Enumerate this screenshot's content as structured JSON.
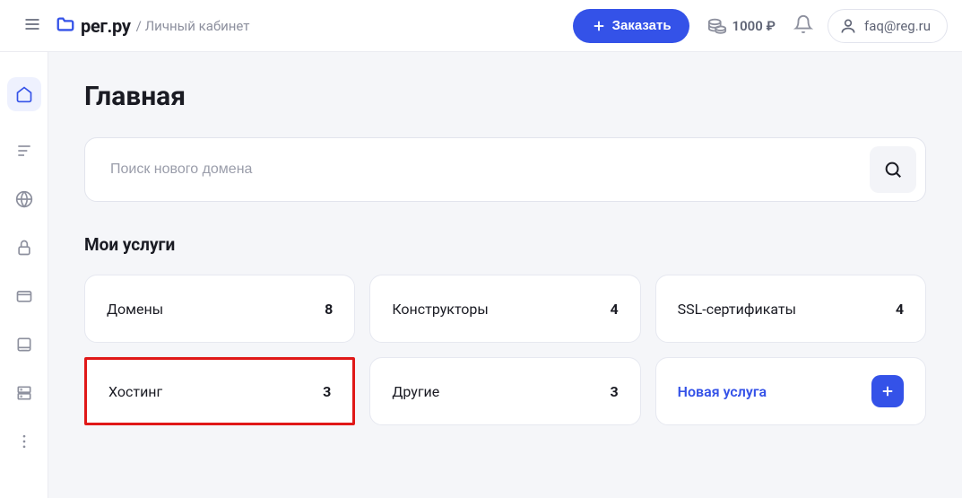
{
  "header": {
    "logo_text": "рег.ру",
    "breadcrumb": "/ Личный кабинет",
    "order_label": "Заказать",
    "balance": "1000 ₽",
    "user_email": "faq@reg.ru"
  },
  "main": {
    "title": "Главная",
    "search_placeholder": "Поиск нового домена",
    "section_title": "Мои услуги",
    "cards": [
      {
        "label": "Домены",
        "count": "8"
      },
      {
        "label": "Конструкторы",
        "count": "4"
      },
      {
        "label": "SSL-сертификаты",
        "count": "4"
      },
      {
        "label": "Хостинг",
        "count": "3"
      },
      {
        "label": "Другие",
        "count": "3"
      },
      {
        "label": "Новая услуга"
      }
    ]
  }
}
